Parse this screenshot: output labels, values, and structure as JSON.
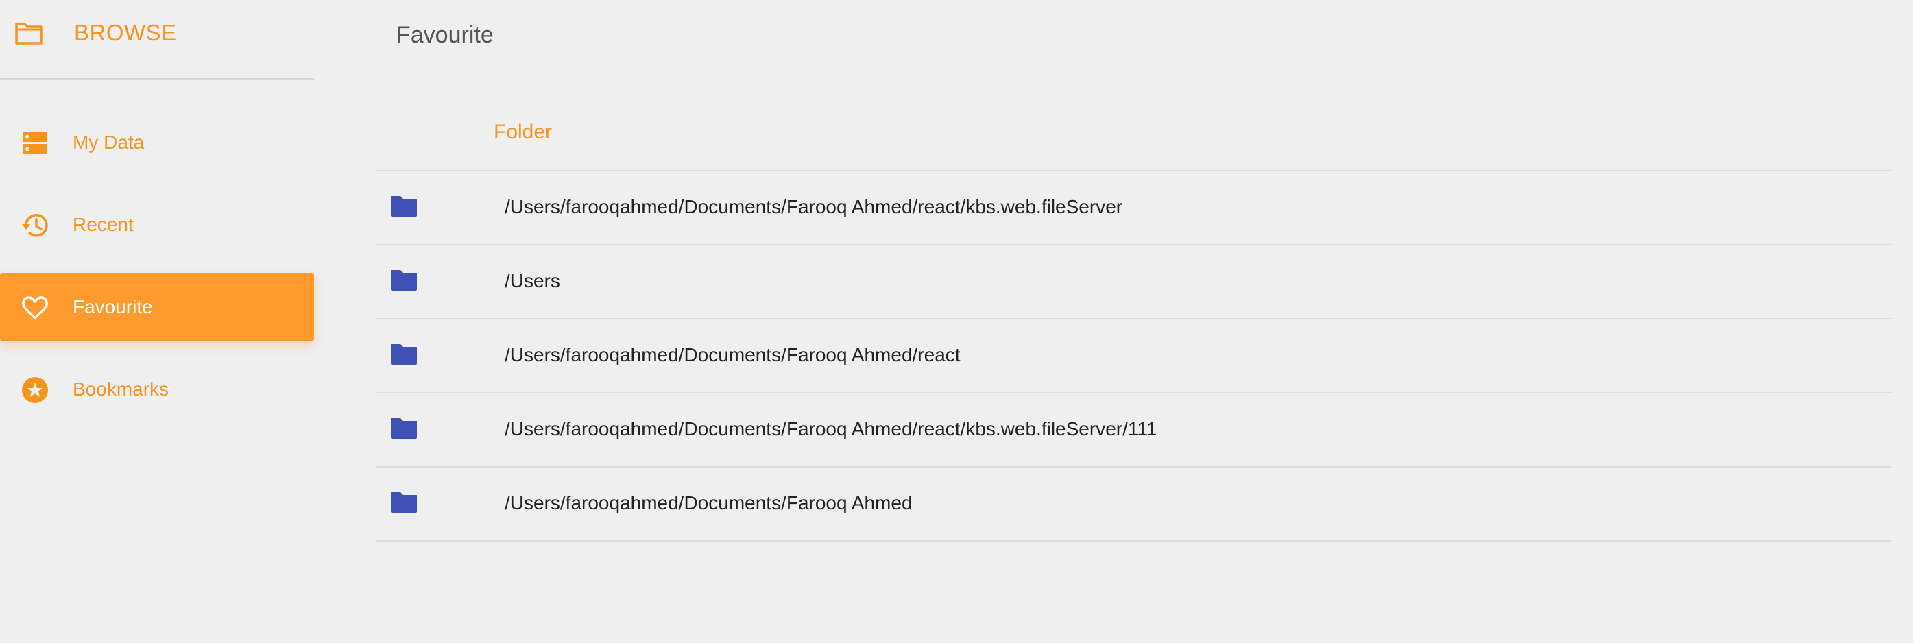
{
  "sidebar": {
    "brand": {
      "title": "BROWSE",
      "icon": "folder-outline-icon"
    },
    "items": [
      {
        "label": "My Data",
        "icon": "storage-icon",
        "active": false
      },
      {
        "label": "Recent",
        "icon": "history-icon",
        "active": false
      },
      {
        "label": "Favourite",
        "icon": "heart-icon",
        "active": true
      },
      {
        "label": "Bookmarks",
        "icon": "star-circle-icon",
        "active": false
      }
    ]
  },
  "main": {
    "title": "Favourite",
    "table": {
      "column_header": "Folder",
      "rows": [
        {
          "path": "/Users/farooqahmed/Documents/Farooq Ahmed/react/kbs.web.fileServer",
          "icon": "folder-icon"
        },
        {
          "path": "/Users",
          "icon": "folder-icon"
        },
        {
          "path": "/Users/farooqahmed/Documents/Farooq Ahmed/react",
          "icon": "folder-icon"
        },
        {
          "path": "/Users/farooqahmed/Documents/Farooq Ahmed/react/kbs.web.fileServer/111",
          "icon": "folder-icon"
        },
        {
          "path": "/Users/farooqahmed/Documents/Farooq Ahmed",
          "icon": "folder-icon"
        }
      ]
    }
  },
  "colors": {
    "accent": "#f7941d",
    "active_bg": "#ff9a2e",
    "folder_blue": "#3f51b5",
    "background": "#efefef",
    "divider": "#dcdcdc"
  }
}
